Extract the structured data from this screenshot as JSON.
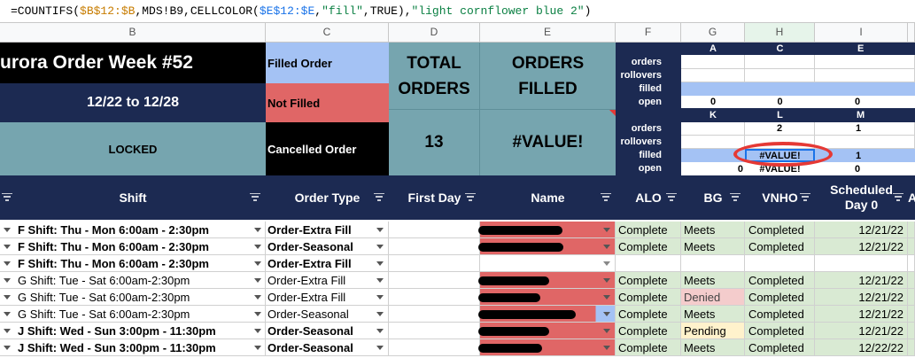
{
  "formula": {
    "prefix": "=COUNTIFS(",
    "ref1": "$B$12:$B",
    "mid1": ",MDS!B9,CELLCOLOR(",
    "ref2": "$E$12:$E",
    "mid2": ",",
    "str1": "\"fill\"",
    "mid3": ",TRUE),",
    "str2": "\"light cornflower blue 2\"",
    "suffix": ")"
  },
  "columns": [
    "B",
    "C",
    "D",
    "E",
    "F",
    "G",
    "H",
    "I"
  ],
  "header": {
    "title": "urora Order Week  #52",
    "dates": "12/22 to 12/28",
    "locked": "LOCKED",
    "legend_filled": "Filled Order",
    "legend_not_filled": "Not Filled",
    "legend_cancelled": "Cancelled Order",
    "total_label": "TOTAL\nORDERS",
    "total_value": "13",
    "filled_label": "ORDERS\nFILLED",
    "filled_value": "#VALUE!"
  },
  "summary": {
    "top_letters": [
      "A",
      "C",
      "E"
    ],
    "bottom_letters": [
      "K",
      "L",
      "M"
    ],
    "row_labels": [
      "orders",
      "rollovers",
      "filled",
      "open"
    ],
    "top_values": {
      "open": [
        "0",
        "0",
        "0"
      ]
    },
    "bottom_values": {
      "orders": [
        "",
        "2",
        "1"
      ],
      "filled": [
        "",
        "#VALUE!",
        "1"
      ],
      "open": [
        "0",
        "#VALUE!",
        "0"
      ]
    }
  },
  "table_headers": [
    "Shift",
    "Order Type",
    "First Day",
    "Name",
    "ALO",
    "BG",
    "VNHO",
    "Scheduled\nDay 0",
    "A"
  ],
  "rows": [
    {
      "shift": "F Shift:  Thu - Mon     6:00am - 2:30pm",
      "bold": true,
      "order": "Order-Extra Fill",
      "name_color": "#e06666",
      "alo": "Complete",
      "bg": "Meets",
      "bg_color": "#d9ead3",
      "vnho": "Completed",
      "day0": "12/21/22"
    },
    {
      "shift": "F Shift:  Thu - Mon     6:00am - 2:30pm",
      "bold": true,
      "order": "Order-Seasonal",
      "name_color": "#e06666",
      "alo": "Complete",
      "bg": "Meets",
      "bg_color": "#d9ead3",
      "vnho": "Completed",
      "day0": "12/21/22"
    },
    {
      "shift": "F Shift:  Thu - Mon     6:00am - 2:30pm",
      "bold": true,
      "order": "Order-Extra Fill",
      "name_color": "#ffffff",
      "alo": "",
      "bg": "",
      "bg_color": "#ffffff",
      "vnho": "",
      "day0": ""
    },
    {
      "shift": "G Shift:  Tue - Sat    6:00am-2:30pm",
      "bold": false,
      "order": "Order-Extra Fill",
      "name_color": "#e06666",
      "alo": "Complete",
      "bg": "Meets",
      "bg_color": "#d9ead3",
      "vnho": "Completed",
      "day0": "12/21/22"
    },
    {
      "shift": "G Shift:  Tue - Sat    6:00am-2:30pm",
      "bold": false,
      "order": "Order-Extra Fill",
      "name_color": "#e06666",
      "alo": "Complete",
      "bg": "Denied",
      "bg_color": "#f4cccc",
      "vnho": "Completed",
      "day0": "12/21/22"
    },
    {
      "shift": "G Shift:  Tue - Sat    6:00am-2:30pm",
      "bold": false,
      "order": "Order-Seasonal",
      "name_color": "#e06666",
      "alo": "Complete",
      "bg": "Meets",
      "bg_color": "#d9ead3",
      "vnho": "Completed",
      "day0": "12/21/22"
    },
    {
      "shift": "J Shift:   Wed - Sun     3:00pm - 11:30pm",
      "bold": true,
      "order": "Order-Seasonal",
      "name_color": "#e06666",
      "alo": "Complete",
      "bg": "Pending",
      "bg_color": "#fff2cc",
      "vnho": "Completed",
      "day0": "12/21/22"
    },
    {
      "shift": "J Shift:   Wed - Sun     3:00pm - 11:30pm",
      "bold": true,
      "order": "Order-Seasonal",
      "name_color": "#e06666",
      "alo": "Complete",
      "bg": "Meets",
      "bg_color": "#d9ead3",
      "vnho": "Completed",
      "day0": "12/22/22"
    }
  ],
  "colors": {
    "navy": "#1c2a52",
    "teal": "#76a5af",
    "light_blue": "#a4c2f4",
    "red": "#e06666",
    "green_light": "#d9ead3",
    "highlight_circle": "#e53935"
  }
}
